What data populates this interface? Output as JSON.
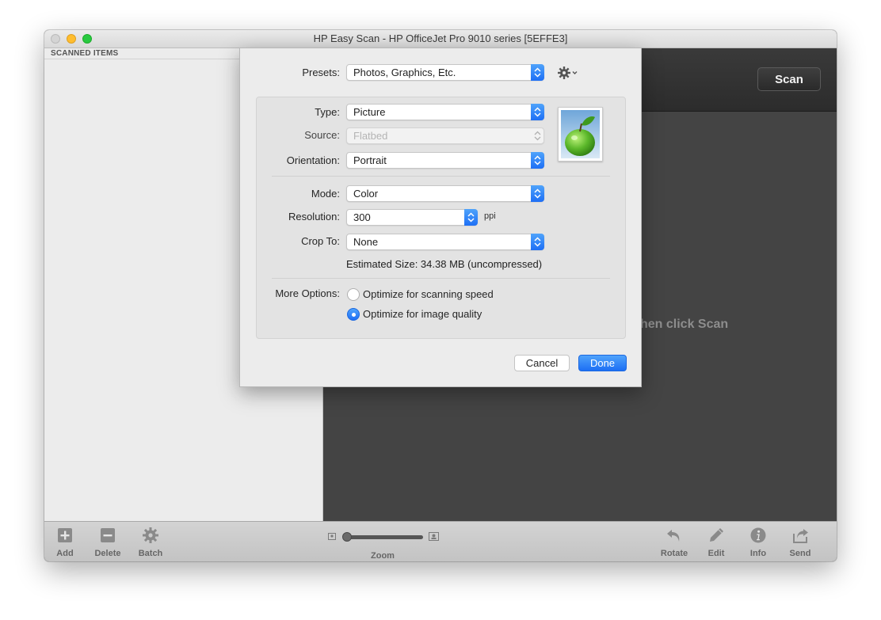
{
  "window": {
    "title": "HP Easy Scan - HP OfficeJet Pro 9010 series [5EFFE3]"
  },
  "sidebar": {
    "header": "SCANNED ITEMS"
  },
  "main": {
    "scan_label": "Scan",
    "hint": "hen click Scan"
  },
  "toolbar": {
    "add_label": "Add",
    "delete_label": "Delete",
    "batch_label": "Batch",
    "zoom_label": "Zoom",
    "rotate_label": "Rotate",
    "edit_label": "Edit",
    "info_label": "Info",
    "send_label": "Send",
    "zoom_level": 0.0
  },
  "sheet": {
    "presets_label": "Presets:",
    "presets_value": "Photos, Graphics, Etc.",
    "type_label": "Type:",
    "type_value": "Picture",
    "source_label": "Source:",
    "source_value": "Flatbed",
    "orientation_label": "Orientation:",
    "orientation_value": "Portrait",
    "mode_label": "Mode:",
    "mode_value": "Color",
    "resolution_label": "Resolution:",
    "resolution_value": "300",
    "resolution_unit": "ppi",
    "crop_label": "Crop To:",
    "crop_value": "None",
    "estimated_size": "Estimated Size: 34.38 MB (uncompressed)",
    "more_options_label": "More Options:",
    "option_speed": "Optimize for scanning speed",
    "option_quality": "Optimize for image quality",
    "selected_option": "quality",
    "cancel_label": "Cancel",
    "done_label": "Done"
  },
  "colors": {
    "accent": "#2a7cf7",
    "sheet_background": "#ececec",
    "main_background": "#444444"
  }
}
